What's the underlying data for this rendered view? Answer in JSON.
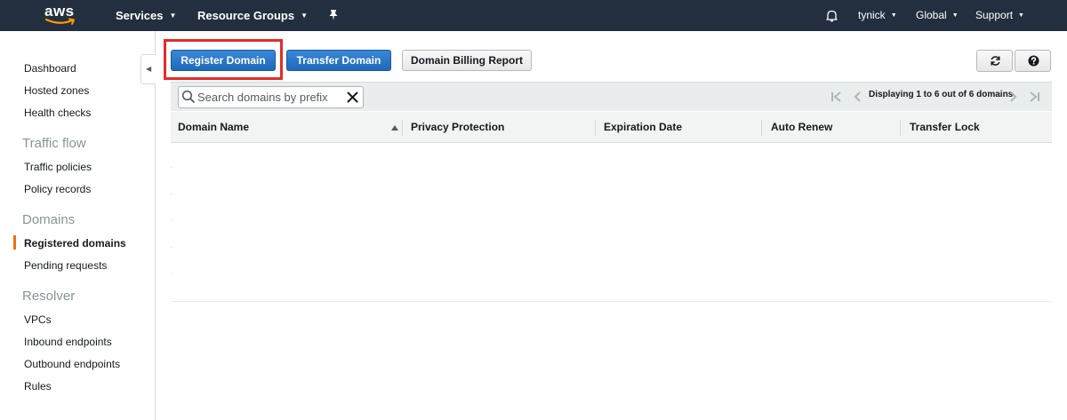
{
  "topnav": {
    "logo_text": "aws",
    "services_label": "Services",
    "resource_groups_label": "Resource Groups",
    "user_label": "tynick",
    "region_label": "Global",
    "support_label": "Support",
    "caret": "▼"
  },
  "sidebar": {
    "collapse_glyph": "◀",
    "items": [
      {
        "label": "Dashboard"
      },
      {
        "label": "Hosted zones"
      },
      {
        "label": "Health checks"
      }
    ],
    "sections": [
      {
        "heading": "Traffic flow",
        "items": [
          {
            "label": "Traffic policies"
          },
          {
            "label": "Policy records"
          }
        ]
      },
      {
        "heading": "Domains",
        "items": [
          {
            "label": "Registered domains",
            "active": true
          },
          {
            "label": "Pending requests"
          }
        ]
      },
      {
        "heading": "Resolver",
        "items": [
          {
            "label": "VPCs"
          },
          {
            "label": "Inbound endpoints"
          },
          {
            "label": "Outbound endpoints"
          },
          {
            "label": "Rules"
          }
        ]
      }
    ]
  },
  "toolbar": {
    "register_label": "Register Domain",
    "transfer_label": "Transfer Domain",
    "billing_label": "Domain Billing Report",
    "refresh_icon": "refresh-icon",
    "help_icon": "help-icon"
  },
  "table": {
    "search_placeholder": "Search domains by prefix",
    "pager_text": "Displaying 1 to 6 out of 6 domains",
    "columns": [
      "Domain Name",
      "Privacy Protection",
      "Expiration Date",
      "Auto Renew",
      "Transfer Lock"
    ],
    "sort_column": "Domain Name",
    "sort_direction": "ascending"
  },
  "colors": {
    "nav_bg": "#232f3e",
    "primary": "#1f70c1",
    "active_marker": "#ec7211",
    "highlight": "#e32b2b"
  }
}
